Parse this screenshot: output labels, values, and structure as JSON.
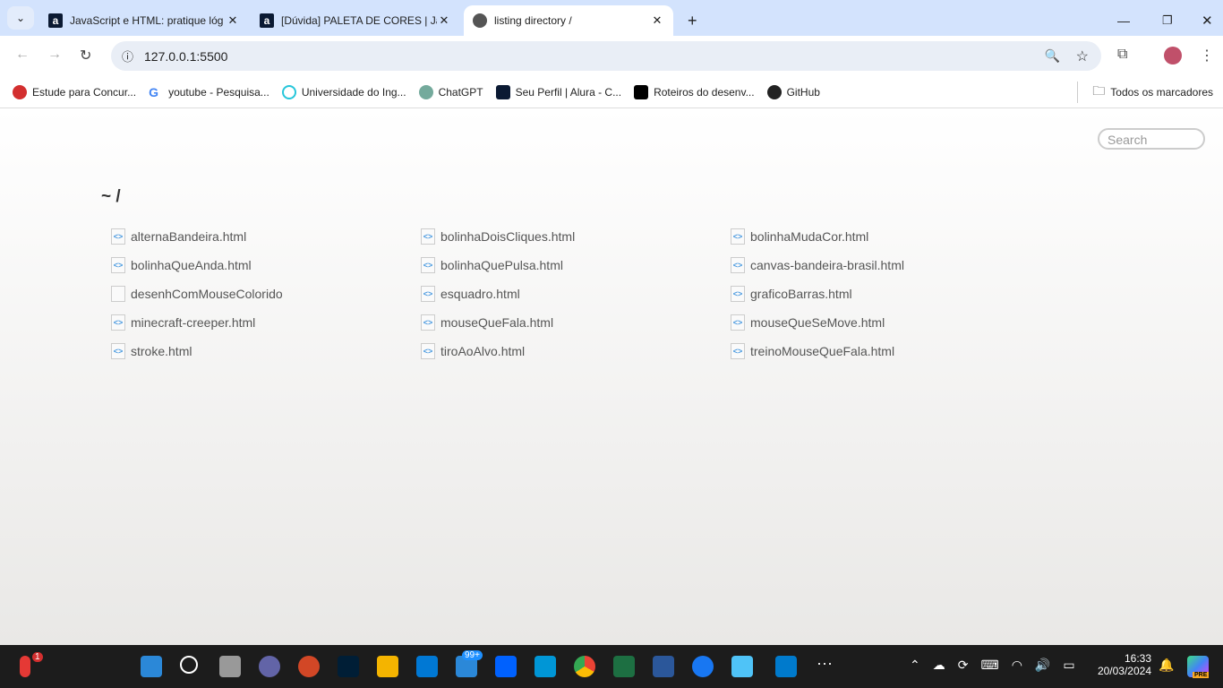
{
  "browser": {
    "tabs": [
      {
        "title": "JavaScript e HTML: pratique lóg",
        "icon": "alura-icon"
      },
      {
        "title": "[Dúvida] PALETA DE CORES | Jav",
        "icon": "alura-icon"
      },
      {
        "title": "listing directory /",
        "icon": "globe-icon",
        "active": true
      }
    ],
    "url": "127.0.0.1:5500",
    "bookmarks": [
      {
        "label": "Estude para Concur...",
        "color": "#d32f2f"
      },
      {
        "label": "youtube - Pesquisa...",
        "color": "#4285f4"
      },
      {
        "label": "Universidade do Ing...",
        "color": "#26c6da"
      },
      {
        "label": "ChatGPT",
        "color": "#74aa9c"
      },
      {
        "label": "Seu Perfil | Alura - C...",
        "color": "#0b1a33"
      },
      {
        "label": "Roteiros do desenv...",
        "color": "#000000"
      },
      {
        "label": "GitHub",
        "color": "#222222"
      }
    ],
    "all_bookmarks": "Todos os marcadores"
  },
  "page": {
    "search_placeholder": "Search",
    "heading": "~ /",
    "files": [
      {
        "name": "alternaBandeira.html",
        "type": "html"
      },
      {
        "name": "bolinhaDoisCliques.html",
        "type": "html"
      },
      {
        "name": "bolinhaMudaCor.html",
        "type": "html"
      },
      {
        "name": "bolinhaQueAnda.html",
        "type": "html"
      },
      {
        "name": "bolinhaQuePulsa.html",
        "type": "html"
      },
      {
        "name": "canvas-bandeira-brasil.html",
        "type": "html"
      },
      {
        "name": "desenhComMouseColorido",
        "type": "file"
      },
      {
        "name": "esquadro.html",
        "type": "html"
      },
      {
        "name": "graficoBarras.html",
        "type": "html"
      },
      {
        "name": "minecraft-creeper.html",
        "type": "html"
      },
      {
        "name": "mouseQueFala.html",
        "type": "html"
      },
      {
        "name": "mouseQueSeMove.html",
        "type": "html"
      },
      {
        "name": "stroke.html",
        "type": "html"
      },
      {
        "name": "tiroAoAlvo.html",
        "type": "html"
      },
      {
        "name": "treinoMouseQueFala.html",
        "type": "html"
      }
    ]
  },
  "taskbar": {
    "weather_badge": "1",
    "mail_badge": "99+",
    "time": "16:33",
    "date": "20/03/2024",
    "copilot_badge": "PRE"
  }
}
